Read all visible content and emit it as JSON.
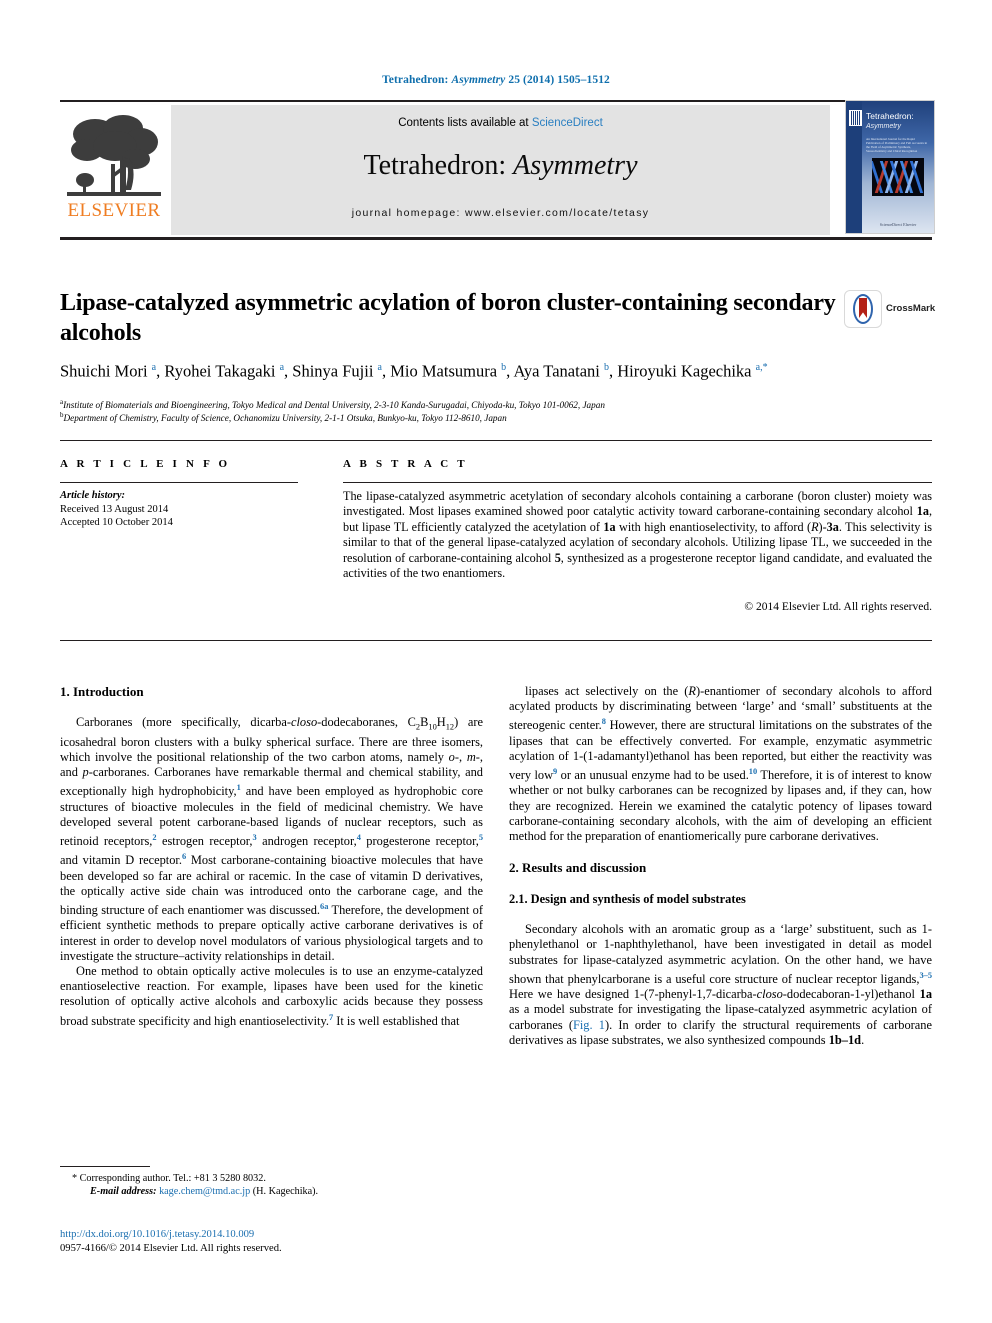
{
  "running_head": {
    "journal": "Tetrahedron:",
    "journal_italic": "Asymmetry",
    "citation": "25 (2014) 1505–1512"
  },
  "masthead": {
    "contents_prefix": "Contents lists available at ",
    "sciencedirect": "ScienceDirect",
    "journal_title_main": "Tetrahedron:",
    "journal_title_italic": "Asymmetry",
    "homepage": "journal homepage: www.elsevier.com/locate/tetasy",
    "publisher_wordmark": "ELSEVIER"
  },
  "cover": {
    "title": "Tetrahedron:",
    "subtitle": "Asymmetry",
    "blurb": "An International Journal for the Rapid Publication of Preliminary and Full Accounts in the Field of Asymmetric Synthesis, Stereochemistry and Chiral Recognition",
    "footer": "ScienceDirect Elsevier"
  },
  "article": {
    "title": "Lipase-catalyzed asymmetric acylation of boron cluster-containing secondary alcohols",
    "crossmark_label": "CrossMark",
    "authors_html": "Shuichi Mori <sup>a</sup>, Ryohei Takagaki <sup>a</sup>, Shinya Fujii <sup>a</sup>, Mio Matsumura <sup>b</sup>, Aya Tanatani <sup>b</sup>, Hiroyuki Kagechika <sup>a,*</sup>",
    "affiliation_a": "Institute of Biomaterials and Bioengineering, Tokyo Medical and Dental University, 2-3-10 Kanda-Surugadai, Chiyoda-ku, Tokyo 101-0062, Japan",
    "affiliation_a_marker": "a",
    "affiliation_b": "Department of Chemistry, Faculty of Science, Ochanomizu University, 2-1-1 Otsuka, Bunkyo-ku, Tokyo 112-8610, Japan",
    "affiliation_b_marker": "b"
  },
  "article_info": {
    "heading": "A R T I C L E   I N F O",
    "history_label": "Article history:",
    "received": "Received 13 August 2014",
    "accepted": "Accepted 10 October 2014"
  },
  "abstract": {
    "heading": "A B S T R A C T",
    "body_html": "The lipase-catalyzed asymmetric acetylation of secondary alcohols containing a carborane (boron cluster) moiety was investigated. Most lipases examined showed poor catalytic activity toward carborane-containing secondary alcohol <b>1a</b>, but lipase TL efficiently catalyzed the acetylation of <b>1a</b> with high enantioselectivity, to afford (<i>R</i>)-<b>3a</b>. This selectivity is similar to that of the general lipase-catalyzed acylation of secondary alcohols. Utilizing lipase TL, we succeeded in the resolution of carborane-containing alcohol <b>5</b>, synthesized as a progesterone receptor ligand candidate, and evaluated the activities of the two enantiomers.",
    "copyright": "© 2014 Elsevier Ltd. All rights reserved."
  },
  "body": {
    "left": {
      "section1_heading": "1. Introduction",
      "para1_html": "Carboranes (more specifically, dicarba-<i>closo</i>-dodecaboranes, C<sub>2</sub>B<sub>10</sub>H<sub>12</sub>) are icosahedral boron clusters with a bulky spherical surface. There are three isomers, which involve the positional relationship of the two carbon atoms, namely <i>o</i>-, <i>m</i>-, and <i>p</i>-carboranes. Carboranes have remarkable thermal and chemical stability, and exceptionally high hydrophobicity,<sup>1</sup> and have been employed as hydrophobic core structures of bioactive molecules in the field of medicinal chemistry. We have developed several potent carborane-based ligands of nuclear receptors, such as retinoid receptors,<sup>2</sup> estrogen receptor,<sup>3</sup> androgen receptor,<sup>4</sup> progesterone receptor,<sup>5</sup> and vitamin D receptor.<sup>6</sup> Most carborane-containing bioactive molecules that have been developed so far are achiral or racemic. In the case of vitamin D derivatives, the optically active side chain was introduced onto the carborane cage, and the binding structure of each enantiomer was discussed.<sup>6a</sup> Therefore, the development of efficient synthetic methods to prepare optically active carborane derivatives is of interest in order to develop novel modulators of various physiological targets and to investigate the structure–activity relationships in detail.",
      "para2_html": "One method to obtain optically active molecules is to use an enzyme-catalyzed enantioselective reaction. For example, lipases have been used for the kinetic resolution of optically active alcohols and carboxylic acids because they possess broad substrate specificity and high enantioselectivity.<sup>7</sup> It is well established that"
    },
    "right": {
      "para1_html": "lipases act selectively on the (<i>R</i>)-enantiomer of secondary alcohols to afford acylated products by discriminating between ‘large’ and ‘small’ substituents at the stereogenic center.<sup>8</sup> However, there are structural limitations on the substrates of the lipases that can be effectively converted. For example, enzymatic asymmetric acylation of 1-(1-adamantyl)ethanol has been reported, but either the reactivity was very low<sup>9</sup> or an unusual enzyme had to be used.<sup>10</sup> Therefore, it is of interest to know whether or not bulky carboranes can be recognized by lipases and, if they can, how they are recognized. Herein we examined the catalytic potency of lipases toward carborane-containing secondary alcohols, with the aim of developing an efficient method for the preparation of enantiomerically pure carborane derivatives.",
      "section2_heading": "2. Results and discussion",
      "section21_heading": "2.1. Design and synthesis of model substrates",
      "para2_html": "Secondary alcohols with an aromatic group as a ‘large’ substituent, such as 1-phenylethanol or 1-naphthylethanol, have been investigated in detail as model substrates for lipase-catalyzed asymmetric acylation. On the other hand, we have shown that phenylcarborane is a useful core structure of nuclear receptor ligands,<sup>3–5</sup> Here we have designed 1-(7-phenyl-1,7-dicarba-<i>closo</i>-dodecaboran-1-yl)ethanol <b>1a</b> as a model substrate for investigating the lipase-catalyzed asymmetric acylation of carboranes (<span class=\"lnk\">Fig. 1</span>). In order to clarify the structural requirements of carborane derivatives as lipase substrates, we also synthesized compounds <b>1b–1d</b>."
    }
  },
  "footnote": {
    "marker": "*",
    "corresponding": "Corresponding author. Tel.: +81 3 5280 8032.",
    "email_label": "E-mail address:",
    "email": "kage.chem@tmd.ac.jp",
    "email_owner": "(H. Kagechika)."
  },
  "footer": {
    "doi": "http://dx.doi.org/10.1016/j.tetasy.2014.10.009",
    "issn_line": "0957-4166/© 2014 Elsevier Ltd. All rights reserved."
  },
  "colors": {
    "link": "#1b6fb0",
    "elsevier_orange": "#ef7d22",
    "band_gray": "#e3e3e3"
  }
}
